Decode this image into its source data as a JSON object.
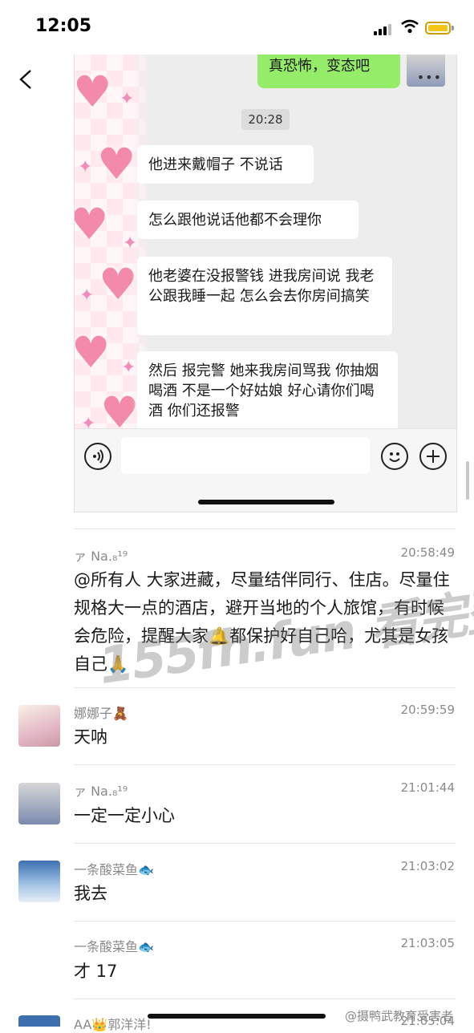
{
  "status_bar": {
    "time": "12:05"
  },
  "embedded_chat": {
    "my_message": "真恐怖，变态吧",
    "time_chip": "20:28",
    "messages": [
      "他进来戴帽子 不说话",
      "怎么跟他说话他都不会理你",
      "他老婆在没报警钱 进我房间说 我老公跟我睡一起 怎么会去你房间搞笑",
      "然后 报完警 她来我房间骂我 你抽烟喝酒 不是一个好姑娘 好心请你们喝酒 你们还报警"
    ]
  },
  "group_messages": [
    {
      "name": "ァ Na.₈¹⁹",
      "time": "20:58:49",
      "text": "@所有人 大家进藏，尽量结伴同行、住店。尽量住规格大一点的酒店，避开当地的个人旅馆，有时候会危险，提醒大家🔔都保护好自己哈，尤其是女孩自己🙏"
    },
    {
      "name": "娜娜子🧸",
      "time": "20:59:59",
      "text": "天呐"
    },
    {
      "name": "ァ Na.₈¹⁹",
      "time": "21:01:44",
      "text": "一定一定小心"
    },
    {
      "name": "一条酸菜鱼🐟",
      "time": "21:03:02",
      "text": "我去"
    },
    {
      "name": "一条酸菜鱼🐟",
      "time": "21:03:05",
      "text": "才 17"
    },
    {
      "name": "AA👑郭洋洋!",
      "time": "21:05:04",
      "text": ""
    }
  ],
  "watermark": "155fh.fun 看完整版",
  "credit": "@摄鸭武教育受害者",
  "colors": {
    "mine_bubble": "#95ec69",
    "chat_bg": "#ededed",
    "battery": "#f5c518"
  }
}
